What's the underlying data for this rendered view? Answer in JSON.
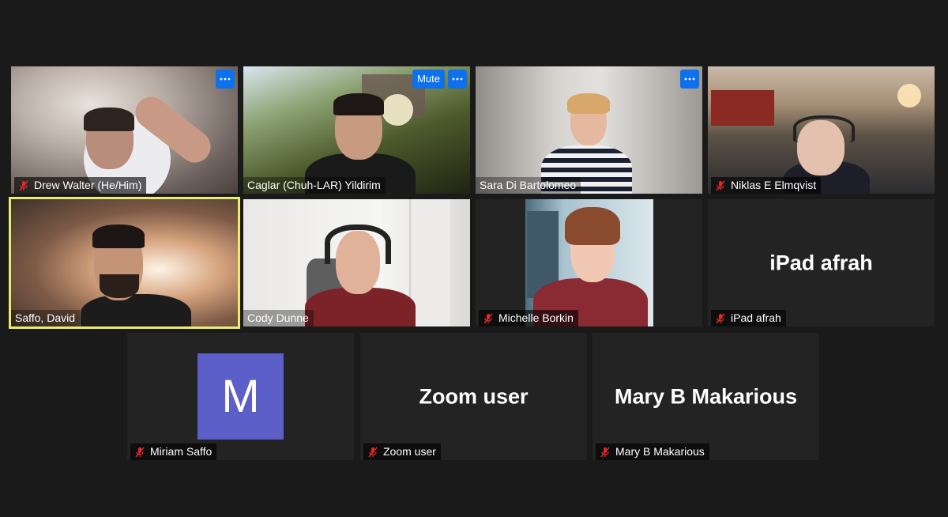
{
  "meeting_app": "Zoom",
  "colors": {
    "background": "#1a1a1a",
    "tile_bg": "#232323",
    "active_speaker_border": "#e9ec6c",
    "button_blue": "#0e71eb",
    "muted_icon": "#e02828",
    "avatar_bg": "#5b5fc7"
  },
  "participants": [
    {
      "name": "Drew Walter (He/Him)",
      "muted": true,
      "video": true,
      "controls": {
        "more": "more-options-icon"
      }
    },
    {
      "name": "Caglar (Chuh-LAR) Yildirim",
      "muted": false,
      "video": true,
      "controls": {
        "mute_label": "Mute",
        "more": "more-options-icon"
      }
    },
    {
      "name": "Sara Di Bartolomeo",
      "muted": false,
      "video": true,
      "controls": {
        "more": "more-options-icon"
      }
    },
    {
      "name": "Niklas E Elmqvist",
      "muted": true,
      "video": true
    },
    {
      "name": "Saffo, David",
      "muted": false,
      "video": true,
      "active_speaker": true
    },
    {
      "name": "Cody Dunne",
      "muted": false,
      "video": true
    },
    {
      "name": "Michelle Borkin",
      "muted": true,
      "video": true
    },
    {
      "name": "iPad afrah",
      "muted": true,
      "video": false,
      "display_text": "iPad afrah"
    },
    {
      "name": "Miriam Saffo",
      "muted": true,
      "video": false,
      "avatar_initial": "M"
    },
    {
      "name": "Zoom user",
      "muted": true,
      "video": false,
      "display_text": "Zoom user"
    },
    {
      "name": "Mary B Makarious",
      "muted": true,
      "video": false,
      "display_text": "Mary B Makarious"
    }
  ]
}
